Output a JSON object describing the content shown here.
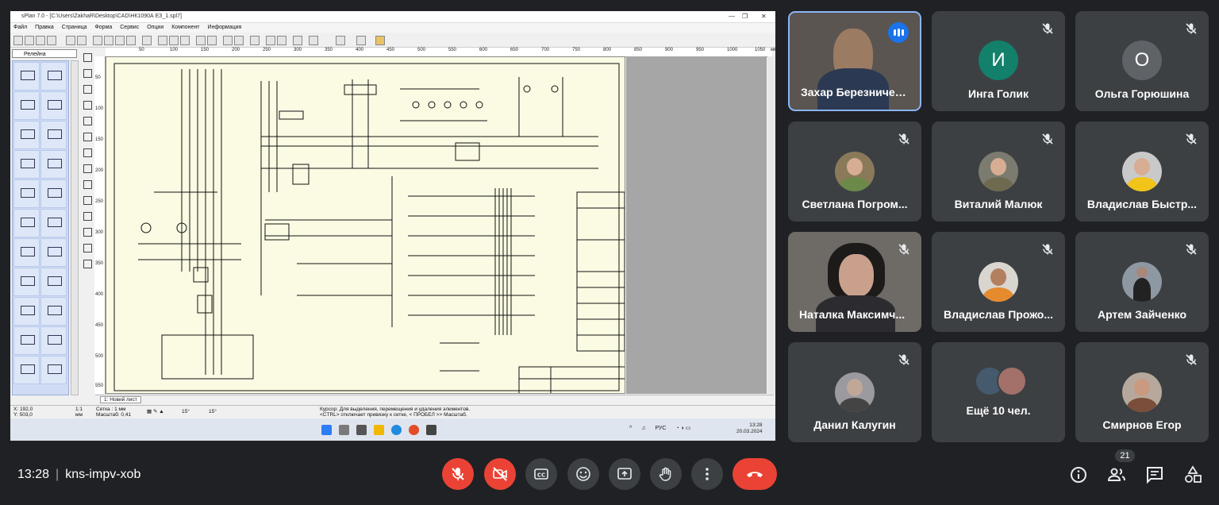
{
  "app": {
    "title": "sPlan 7.0 - [C:\\Users\\ZakhaR\\Desktop\\CAD\\НК1090А ЕЗ_1.spl7]",
    "menu": [
      "Файл",
      "Правка",
      "Страница",
      "Форма",
      "Сервис",
      "Опции",
      "Компонент",
      "Информация"
    ],
    "library_select": "Релейна",
    "ruler_top": [
      "50",
      "100",
      "150",
      "200",
      "250",
      "300",
      "350",
      "400",
      "450",
      "500",
      "550",
      "600",
      "650",
      "700",
      "750",
      "800",
      "850",
      "900",
      "950",
      "1000",
      "1050"
    ],
    "ruler_unit": "мм",
    "ruler_left": [
      "50",
      "100",
      "150",
      "200",
      "250",
      "300",
      "350",
      "400",
      "450",
      "500",
      "550"
    ],
    "sheet_tab": "1: Новий лист",
    "status": {
      "coord_x": "X: 192,0",
      "coord_y": "Y: 503,0",
      "unit_value": "1:1",
      "unit": "мм",
      "grid": "Сетка : 1 мм",
      "scale": "Масштаб: 0,41",
      "angle1": "15°",
      "angle2": "15°",
      "hint1": "Курсор: Для выделения, перемещения и удаления элементов.",
      "hint2": "<CTRL> отключает привязку к сетке, < ПРОБЕЛ >> Масштаб."
    },
    "taskbar": {
      "tray_lang": "РУС",
      "time": "13:28",
      "date": "20.03.2024"
    },
    "colors": {
      "canvas": "#fbfae3",
      "library": "#cfdcf4"
    }
  },
  "participants": [
    {
      "name": "Захар Березничен...",
      "type": "video",
      "speaking": true
    },
    {
      "name": "Инга Голик",
      "type": "initial",
      "initial": "И",
      "color": "#12806a",
      "muted": true
    },
    {
      "name": "Ольга Горюшина",
      "type": "initial",
      "initial": "О",
      "color": "#5f6368",
      "muted": true
    },
    {
      "name": "Светлана Погром...",
      "type": "avatar",
      "muted": true
    },
    {
      "name": "Виталий Малюк",
      "type": "avatar",
      "muted": true
    },
    {
      "name": "Владислав Быстр...",
      "type": "avatar",
      "muted": true
    },
    {
      "name": "Наталка Максимч...",
      "type": "video",
      "muted": true
    },
    {
      "name": "Владислав Прожо...",
      "type": "avatar",
      "muted": true
    },
    {
      "name": "Артем Зайченко",
      "type": "avatar",
      "muted": true
    },
    {
      "name": "Данил Калугин",
      "type": "avatar",
      "muted": true
    },
    {
      "name": "Ещё 10 чел.",
      "type": "group"
    },
    {
      "name": "Смирнов Егор",
      "type": "avatar",
      "muted": true
    }
  ],
  "meeting": {
    "time": "13:28",
    "code": "kns-impv-xob",
    "participant_count": "21"
  },
  "icons": {
    "mic": "mic-off-icon",
    "camera": "camera-off-icon",
    "captions": "captions-icon",
    "emoji": "emoji-icon",
    "present": "present-icon",
    "hand": "raise-hand-icon",
    "more": "more-options-icon",
    "end": "end-call-icon",
    "info": "info-icon",
    "people": "people-icon",
    "chat": "chat-icon",
    "activities": "activities-icon"
  }
}
